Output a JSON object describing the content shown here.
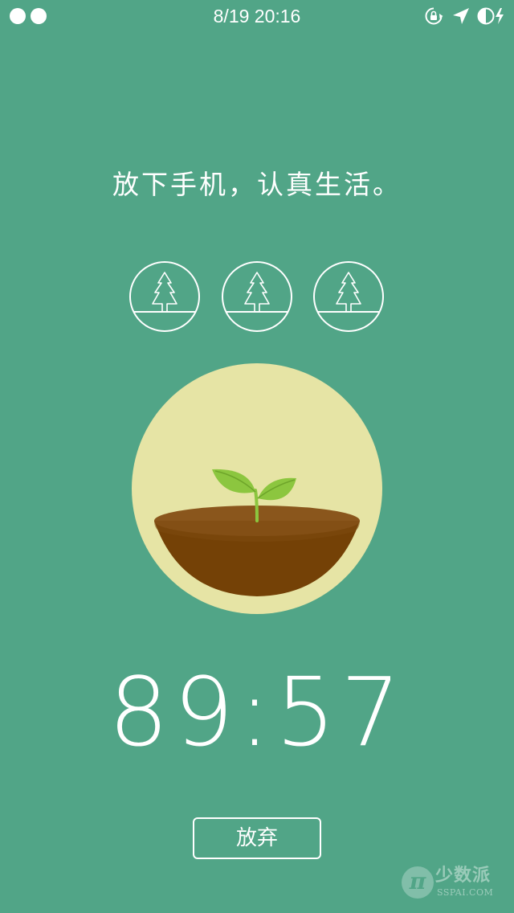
{
  "status_bar": {
    "time": "8/19 20:16",
    "left_indicators": [
      "signal-dot",
      "signal-dot"
    ],
    "right_icons": [
      "rotation-lock-icon",
      "location-arrow-icon",
      "battery-charging-icon"
    ]
  },
  "main": {
    "motto": "放下手机，认真生活。",
    "badges": [
      {
        "icon": "pine-tree-icon"
      },
      {
        "icon": "pine-tree-icon"
      },
      {
        "icon": "pine-tree-icon"
      }
    ],
    "timer": {
      "minutes": "89",
      "separator": ":",
      "seconds": "57"
    },
    "give_up_label": "放弃"
  },
  "watermark": {
    "logo_glyph": "π",
    "name": "少数派",
    "domain": "SSPAI.COM"
  },
  "colors": {
    "background": "#51a587",
    "pot_circle": "#e6e4a5",
    "soil_top": "#8a561c",
    "pot_body": "#744106",
    "leaf": "#8cc63f",
    "foreground": "#ffffff"
  }
}
